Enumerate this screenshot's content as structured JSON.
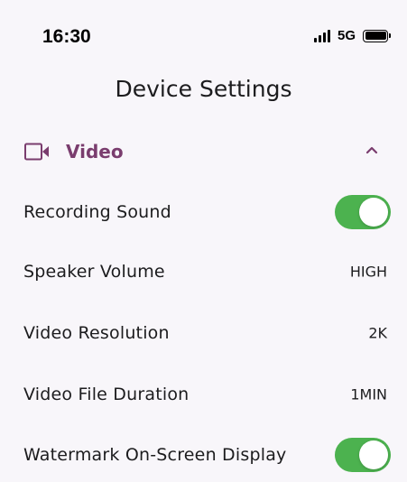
{
  "status_bar": {
    "time": "16:30",
    "network": "5G",
    "signal_icon": "cellular-signal-icon",
    "battery_icon": "battery-full-icon"
  },
  "header": {
    "title": "Device Settings"
  },
  "section": {
    "title": "Video",
    "icon": "video-camera-icon",
    "expand_icon": "chevron-up-icon",
    "accent_color": "#7a3d6e"
  },
  "settings": [
    {
      "label": "Recording Sound",
      "type": "toggle",
      "on": true
    },
    {
      "label": "Speaker Volume",
      "type": "value",
      "value": "HIGH"
    },
    {
      "label": "Video Resolution",
      "type": "value",
      "value": "2K"
    },
    {
      "label": "Video File Duration",
      "type": "value",
      "value": "1MIN"
    },
    {
      "label": "Watermark On-Screen Display",
      "type": "toggle",
      "on": true
    }
  ],
  "colors": {
    "toggle_on": "#4cb24f",
    "background": "#f8f6fa"
  }
}
